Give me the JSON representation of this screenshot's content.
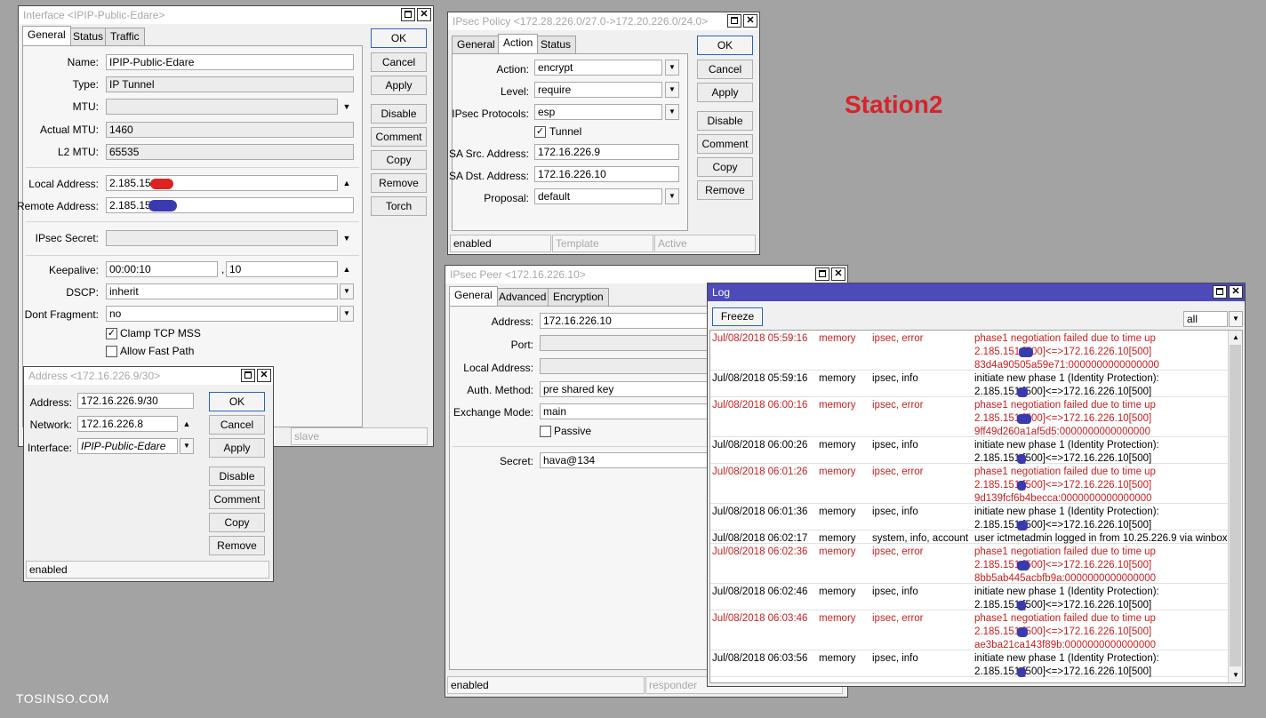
{
  "annotation": "Station2",
  "watermark": "TOSINSO.COM",
  "interface_win": {
    "title": "Interface <IPIP-Public-Edare>",
    "tabs": [
      "General",
      "Status",
      "Traffic"
    ],
    "name_label": "Name:",
    "name": "IPIP-Public-Edare",
    "type_label": "Type:",
    "type": "IP Tunnel",
    "mtu_label": "MTU:",
    "mtu": "",
    "actual_mtu_label": "Actual MTU:",
    "actual_mtu": "1460",
    "l2_mtu_label": "L2 MTU:",
    "l2_mtu": "65535",
    "local_label": "Local Address:",
    "local": "2.185.151",
    "remote_label": "Remote Address:",
    "remote": "2.185.151",
    "ipsec_secret_label": "IPsec Secret:",
    "ipsec_secret": "",
    "keepalive_label": "Keepalive:",
    "keepalive1": "00:00:10",
    "keepalive_sep": ",",
    "keepalive2": "10",
    "dscp_label": "DSCP:",
    "dscp": "inherit",
    "dont_frag_label": "Dont Fragment:",
    "dont_frag": "no",
    "clamp": "Clamp TCP MSS",
    "fastpath": "Allow Fast Path",
    "buttons": [
      "OK",
      "Cancel",
      "Apply",
      "Disable",
      "Comment",
      "Copy",
      "Remove",
      "Torch"
    ],
    "status_slave": "slave"
  },
  "address_win": {
    "title": "Address <172.16.226.9/30>",
    "address_label": "Address:",
    "address": "172.16.226.9/30",
    "network_label": "Network:",
    "network": "172.16.226.8",
    "interface_label": "Interface:",
    "interface": "IPIP-Public-Edare",
    "buttons": [
      "OK",
      "Cancel",
      "Apply",
      "Disable",
      "Comment",
      "Copy",
      "Remove"
    ],
    "status": "enabled"
  },
  "policy_win": {
    "title": "IPsec Policy <172.28.226.0/27.0->172.20.226.0/24.0>",
    "tabs": [
      "General",
      "Action",
      "Status"
    ],
    "action_label": "Action:",
    "action": "encrypt",
    "level_label": "Level:",
    "level": "require",
    "protocols_label": "IPsec Protocols:",
    "protocols": "esp",
    "tunnel": "Tunnel",
    "sa_src_label": "SA Src. Address:",
    "sa_src": "172.16.226.9",
    "sa_dst_label": "SA Dst. Address:",
    "sa_dst": "172.16.226.10",
    "proposal_label": "Proposal:",
    "proposal": "default",
    "buttons": [
      "OK",
      "Cancel",
      "Apply",
      "Disable",
      "Comment",
      "Copy",
      "Remove"
    ],
    "status": [
      "enabled",
      "Template",
      "Active"
    ]
  },
  "peer_win": {
    "title": "IPsec Peer <172.16.226.10>",
    "tabs": [
      "General",
      "Advanced",
      "Encryption"
    ],
    "address_label": "Address:",
    "address": "172.16.226.10",
    "port_label": "Port:",
    "port": "",
    "local_label": "Local Address:",
    "local": "",
    "auth_label": "Auth. Method:",
    "auth": "pre shared key",
    "exchange_label": "Exchange Mode:",
    "exchange": "main",
    "passive": "Passive",
    "secret_label": "Secret:",
    "secret": "hava@134",
    "status": [
      "enabled",
      "responder"
    ]
  },
  "log_win": {
    "title": "Log",
    "freeze": "Freeze",
    "filter": "all",
    "rows": [
      {
        "time": "Jul/08/2018 05:59:16",
        "buffer": "memory",
        "topics": "ipsec, error",
        "err": true,
        "lines": [
          "phase1 negotiation failed due to time up",
          "2.185.151.[500]<=>172.16.226.10[500]",
          "83d4a90505a59e71:0000000000000000"
        ]
      },
      {
        "time": "Jul/08/2018 05:59:16",
        "buffer": "memory",
        "topics": "ipsec, info",
        "err": false,
        "lines": [
          "initiate new phase 1 (Identity Protection):",
          "2.185.151.[500]<=>172.16.226.10[500]"
        ]
      },
      {
        "time": "Jul/08/2018 06:00:16",
        "buffer": "memory",
        "topics": "ipsec, error",
        "err": true,
        "lines": [
          "phase1 negotiation failed due to time up",
          "2.185.151.[500]<=>172.16.226.10[500]",
          "9ff49d260a1af5d5:0000000000000000"
        ]
      },
      {
        "time": "Jul/08/2018 06:00:26",
        "buffer": "memory",
        "topics": "ipsec, info",
        "err": false,
        "lines": [
          "initiate new phase 1 (Identity Protection):",
          "2.185.151.[500]<=>172.16.226.10[500]"
        ]
      },
      {
        "time": "Jul/08/2018 06:01:26",
        "buffer": "memory",
        "topics": "ipsec, error",
        "err": true,
        "lines": [
          "phase1 negotiation failed due to time up",
          "2.185.151.[500]<=>172.16.226.10[500]",
          "9d139fcf6b4becca:0000000000000000"
        ]
      },
      {
        "time": "Jul/08/2018 06:01:36",
        "buffer": "memory",
        "topics": "ipsec, info",
        "err": false,
        "lines": [
          "initiate new phase 1 (Identity Protection):",
          "2.185.151.[500]<=>172.16.226.10[500]"
        ]
      },
      {
        "time": "Jul/08/2018 06:02:17",
        "buffer": "memory",
        "topics": "system, info, account",
        "err": false,
        "lines": [
          "user ictmetadmin logged in from 10.25.226.9 via winbox"
        ]
      },
      {
        "time": "Jul/08/2018 06:02:36",
        "buffer": "memory",
        "topics": "ipsec, error",
        "err": true,
        "lines": [
          "phase1 negotiation failed due to time up",
          "2.185.151.[500]<=>172.16.226.10[500]",
          "8bb5ab445acbfb9a:0000000000000000"
        ]
      },
      {
        "time": "Jul/08/2018 06:02:46",
        "buffer": "memory",
        "topics": "ipsec, info",
        "err": false,
        "lines": [
          "initiate new phase 1 (Identity Protection):",
          "2.185.151.[500]<=>172.16.226.10[500]"
        ]
      },
      {
        "time": "Jul/08/2018 06:03:46",
        "buffer": "memory",
        "topics": "ipsec, error",
        "err": true,
        "lines": [
          "phase1 negotiation failed due to time up",
          "2.185.151.[500]<=>172.16.226.10[500]",
          "ae3ba21ca143f89b:0000000000000000"
        ]
      },
      {
        "time": "Jul/08/2018 06:03:56",
        "buffer": "memory",
        "topics": "ipsec, info",
        "err": false,
        "lines": [
          "initiate new phase 1 (Identity Protection):",
          "2.185.151.[500]<=>172.16.226.10[500]"
        ]
      }
    ]
  }
}
